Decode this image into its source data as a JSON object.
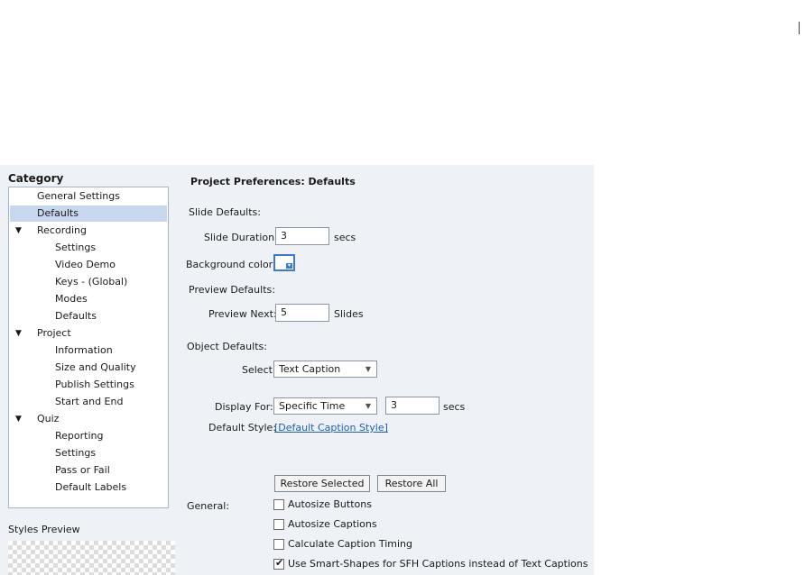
{
  "category": {
    "title": "Category",
    "items": [
      {
        "label": "General Settings",
        "indent": 0,
        "toggle": ""
      },
      {
        "label": "Defaults",
        "indent": 0,
        "toggle": "",
        "selected": true
      },
      {
        "label": "Recording",
        "indent": 0,
        "toggle": "▼"
      },
      {
        "label": "Settings",
        "indent": 1,
        "toggle": ""
      },
      {
        "label": "Video Demo",
        "indent": 1,
        "toggle": ""
      },
      {
        "label": "Keys - (Global)",
        "indent": 1,
        "toggle": ""
      },
      {
        "label": "Modes",
        "indent": 1,
        "toggle": ""
      },
      {
        "label": "Defaults",
        "indent": 1,
        "toggle": ""
      },
      {
        "label": "Project",
        "indent": 0,
        "toggle": "▼"
      },
      {
        "label": "Information",
        "indent": 1,
        "toggle": ""
      },
      {
        "label": "Size and Quality",
        "indent": 1,
        "toggle": ""
      },
      {
        "label": "Publish Settings",
        "indent": 1,
        "toggle": ""
      },
      {
        "label": "Start and End",
        "indent": 1,
        "toggle": ""
      },
      {
        "label": "Quiz",
        "indent": 0,
        "toggle": "▼"
      },
      {
        "label": "Reporting",
        "indent": 1,
        "toggle": ""
      },
      {
        "label": "Settings",
        "indent": 1,
        "toggle": ""
      },
      {
        "label": "Pass or Fail",
        "indent": 1,
        "toggle": ""
      },
      {
        "label": "Default Labels",
        "indent": 1,
        "toggle": ""
      }
    ]
  },
  "styles_preview": {
    "label": "Styles Preview"
  },
  "prefs": {
    "heading": "Project Preferences: Defaults",
    "slide_defaults": {
      "label": "Slide Defaults:",
      "duration_label": "Slide Duration:",
      "duration_value": "3",
      "duration_unit": "secs"
    },
    "background": {
      "label": "Background color:",
      "color": "#ffffff"
    },
    "preview_defaults": {
      "label": "Preview Defaults:",
      "next_label": "Preview Next:",
      "next_value": "5",
      "next_unit": "Slides"
    },
    "object_defaults": {
      "label": "Object Defaults:",
      "select_label": "Select:",
      "select_value": "Text Caption",
      "display_label": "Display For:",
      "display_value": "Specific Time",
      "display_secs_value": "3",
      "display_secs_unit": "secs",
      "style_label": "Default Style:",
      "style_link": "[Default Caption Style]"
    },
    "buttons": {
      "restore_selected": "Restore Selected",
      "restore_all": "Restore All"
    },
    "general": {
      "label": "General:",
      "options": [
        {
          "label": "Autosize Buttons",
          "checked": false,
          "mark": ""
        },
        {
          "label": "Autosize Captions",
          "checked": false,
          "mark": ""
        },
        {
          "label": "Calculate Caption Timing",
          "checked": false,
          "mark": ""
        },
        {
          "label": "Use Smart-Shapes for SFH Captions instead of Text Captions",
          "checked": true,
          "mark": "✔"
        }
      ]
    }
  },
  "colors": {
    "panel_bg": "#eef2f7",
    "selection": "#c7d8ee",
    "accent": "#3c78d8",
    "link": "#1f5fb0"
  }
}
